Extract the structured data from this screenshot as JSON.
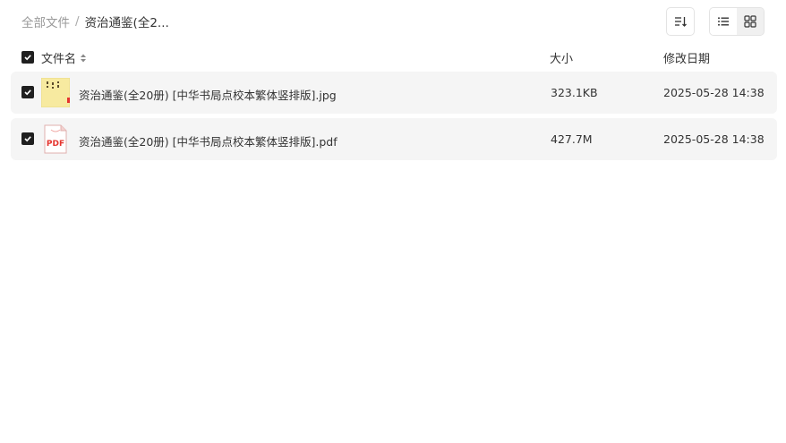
{
  "breadcrumb": {
    "root": "全部文件",
    "separator": "/",
    "current": "资治通鉴(全2..."
  },
  "toolbar": {
    "sort_icon": "sort-icon",
    "list_view_icon": "list-view-icon",
    "grid_view_icon": "grid-view-icon"
  },
  "table": {
    "headers": {
      "name": "文件名",
      "size": "大小",
      "date": "修改日期"
    },
    "rows": [
      {
        "name": "资治通鉴(全20册) [中华书局点校本繁体竖排版].jpg",
        "size": "323.1KB",
        "date": "2025-05-28 14:38",
        "icon": "jpg-thumbnail"
      },
      {
        "name": "资治通鉴(全20册) [中华书局点校本繁体竖排版].pdf",
        "size": "427.7M",
        "date": "2025-05-28 14:38",
        "icon": "pdf-file-icon",
        "icon_text": "PDF"
      }
    ]
  },
  "colors": {
    "row_background": "#f5f5f5",
    "checkbox": "#1f1f1f",
    "pdf_red": "#e5342e",
    "thumb_yellow": "#f7eaa0"
  }
}
